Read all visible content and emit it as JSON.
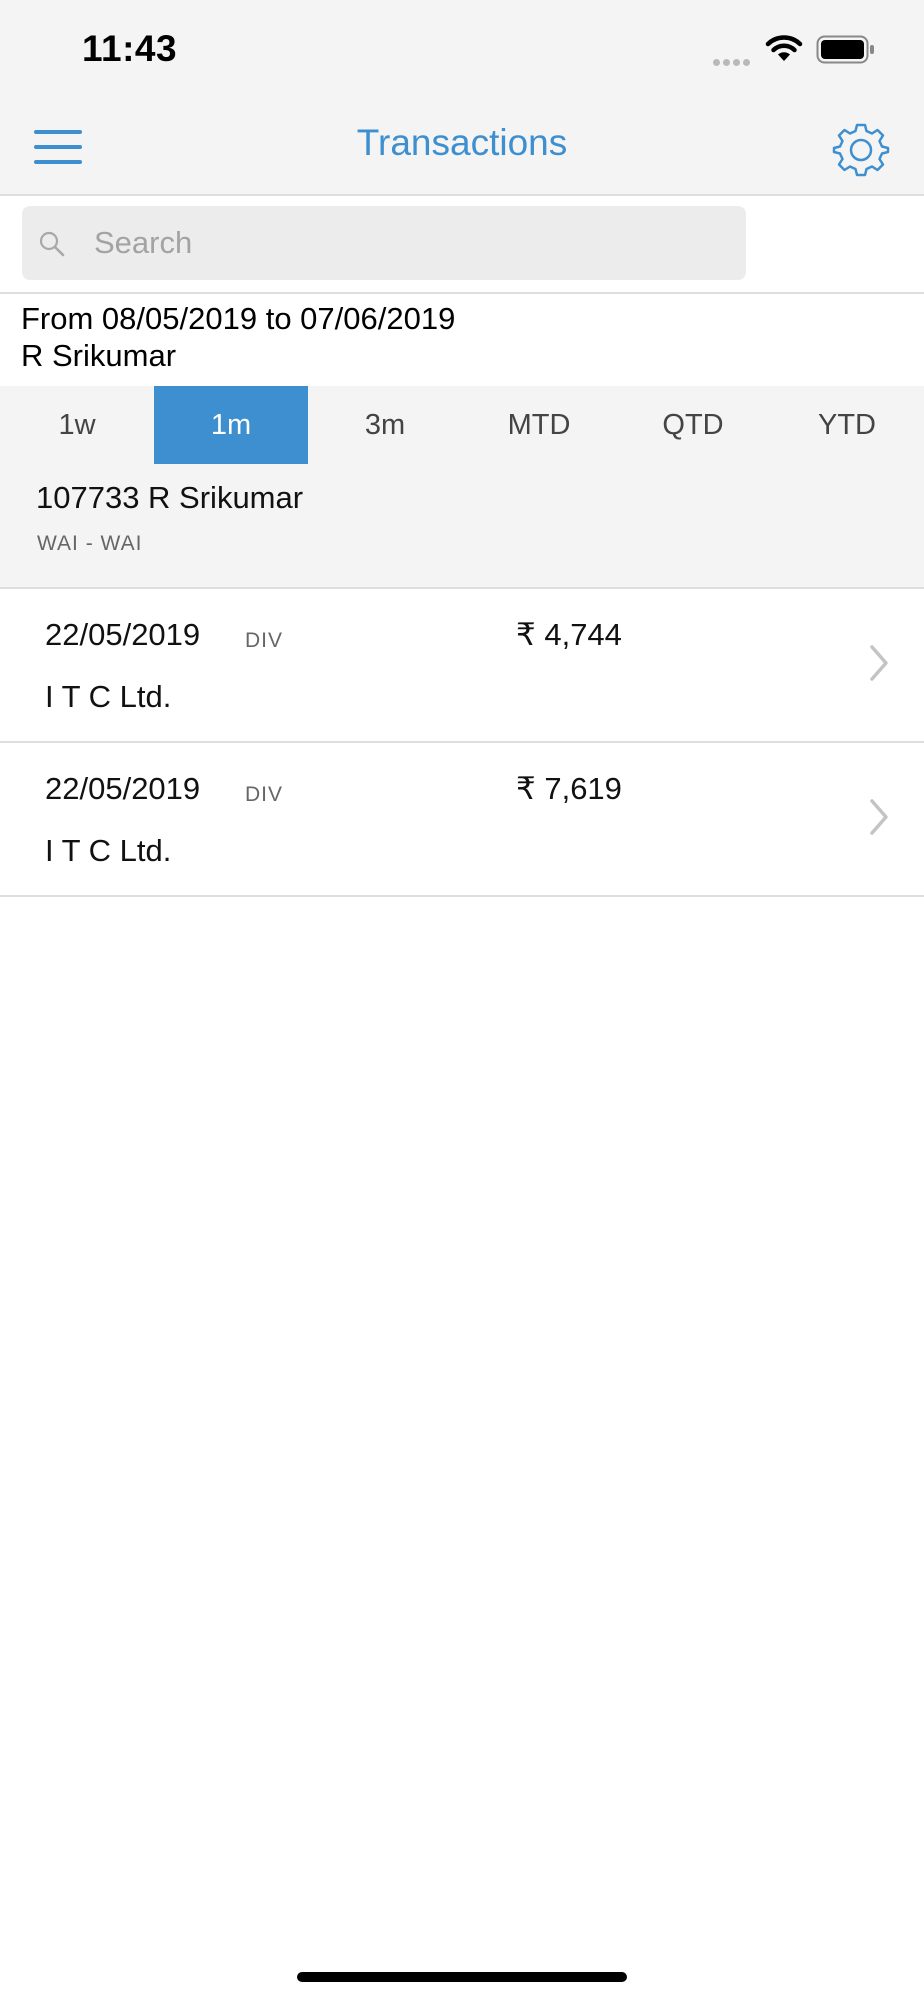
{
  "status_bar": {
    "time": "11:43"
  },
  "nav": {
    "title": "Transactions",
    "menu_icon": "hamburger-menu-icon",
    "settings_icon": "gear-icon"
  },
  "search": {
    "placeholder": "Search",
    "value": ""
  },
  "range": {
    "dates": "From 08/05/2019 to 07/06/2019",
    "client": "R Srikumar"
  },
  "period_tabs": [
    {
      "label": "1w",
      "active": false
    },
    {
      "label": "1m",
      "active": true
    },
    {
      "label": "3m",
      "active": false
    },
    {
      "label": "MTD",
      "active": false
    },
    {
      "label": "QTD",
      "active": false
    },
    {
      "label": "YTD",
      "active": false
    }
  ],
  "account": {
    "name": "107733 R Srikumar",
    "sub": "WAI - WAI"
  },
  "transactions": [
    {
      "date": "22/05/2019",
      "type": "DIV",
      "amount": "₹ 4,744",
      "company": "I T C Ltd."
    },
    {
      "date": "22/05/2019",
      "type": "DIV",
      "amount": "₹ 7,619",
      "company": "I T C Ltd."
    }
  ],
  "colors": {
    "accent": "#3d8fcf",
    "bar_background": "#f4f4f4",
    "divider": "#dedede"
  }
}
